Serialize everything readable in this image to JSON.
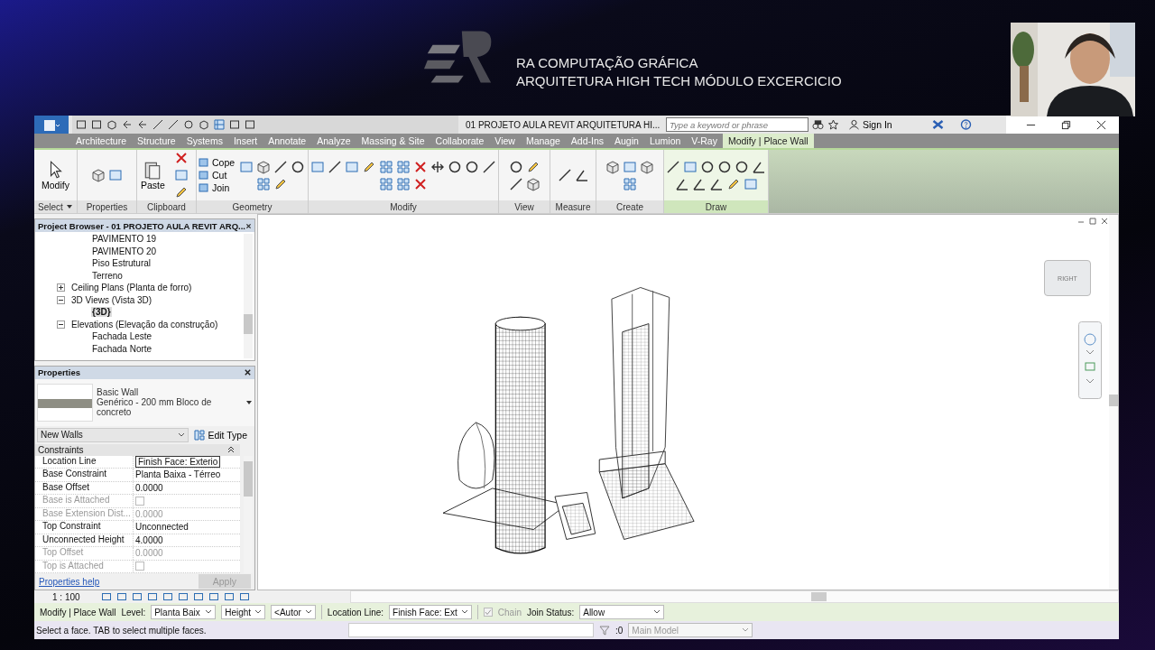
{
  "header": {
    "line1": "RA COMPUTAÇÃO GRÁFICA",
    "line2": "ARQUITETURA HIGH TECH MÓDULO EXCERCICIO"
  },
  "titlebar": {
    "title": "01 PROJETO AULA REVIT ARQUITETURA HI...",
    "search_placeholder": "Type a keyword or phrase",
    "sign_in": "Sign In"
  },
  "tabs": [
    {
      "label": "Architecture",
      "selected": false
    },
    {
      "label": "Structure",
      "selected": false
    },
    {
      "label": "Systems",
      "selected": false
    },
    {
      "label": "Insert",
      "selected": false
    },
    {
      "label": "Annotate",
      "selected": false
    },
    {
      "label": "Analyze",
      "selected": false
    },
    {
      "label": "Massing & Site",
      "selected": false
    },
    {
      "label": "Collaborate",
      "selected": false
    },
    {
      "label": "View",
      "selected": false
    },
    {
      "label": "Manage",
      "selected": false
    },
    {
      "label": "Add-Ins",
      "selected": false
    },
    {
      "label": "Augin",
      "selected": false
    },
    {
      "label": "Lumion",
      "selected": false
    },
    {
      "label": "V-Ray",
      "selected": false
    },
    {
      "label": "Modify | Place Wall",
      "selected": true
    }
  ],
  "ribbon": [
    {
      "label": "Select",
      "kind": "large",
      "menu": true,
      "buttons": [
        "Modify"
      ]
    },
    {
      "label": "Properties",
      "kind": "icons",
      "menu": false
    },
    {
      "label": "Clipboard",
      "kind": "large",
      "menu": false,
      "buttons": [
        "Paste"
      ]
    },
    {
      "label": "Geometry",
      "kind": "list",
      "menu": false,
      "buttons": [
        "Cope",
        "Cut",
        "Join"
      ]
    },
    {
      "label": "Modify",
      "kind": "icons",
      "menu": false
    },
    {
      "label": "View",
      "kind": "icons",
      "menu": false
    },
    {
      "label": "Measure",
      "kind": "icons",
      "menu": false
    },
    {
      "label": "Create",
      "kind": "icons",
      "menu": false
    },
    {
      "label": "Draw",
      "kind": "icons",
      "menu": false
    }
  ],
  "project_browser": {
    "title": "Project Browser - 01 PROJETO AULA REVIT ARQ...",
    "continued": [
      {
        "label": "PAVIMENTO 19",
        "selected": false
      },
      {
        "label": "PAVIMENTO 20",
        "selected": false
      },
      {
        "label": "Piso Estrutural",
        "selected": false
      },
      {
        "label": "Terreno",
        "selected": false
      }
    ],
    "items": [
      {
        "label": "Ceiling Plans (Planta de forro)",
        "expanded": false
      },
      {
        "label": "3D Views (Vista 3D)",
        "expanded": true,
        "children": [
          {
            "label": "{3D}",
            "selected": true
          }
        ]
      },
      {
        "label": "Elevations (Elevação da construção)",
        "expanded": true,
        "children": [
          {
            "label": "Fachada Leste",
            "selected": false
          },
          {
            "label": "Fachada Norte",
            "selected": false
          }
        ]
      }
    ]
  },
  "properties": {
    "title": "Properties",
    "family": "Basic Wall",
    "type": "Genérico - 200 mm Bloco de concreto",
    "filter": "New Walls",
    "edit_type": "Edit Type",
    "group": "Constraints",
    "rows": [
      {
        "name": "Location Line",
        "kind": "field",
        "value": "Finish Face: Exterio",
        "disabled": false
      },
      {
        "name": "Base Constraint",
        "kind": "text",
        "value": "Planta Baixa - Térreo",
        "disabled": false
      },
      {
        "name": "Base Offset",
        "kind": "text",
        "value": "0.0000",
        "disabled": false
      },
      {
        "name": "Base is Attached",
        "kind": "checkbox",
        "checked": false,
        "disabled": true
      },
      {
        "name": "Base Extension Dist...",
        "kind": "text",
        "value": "0.0000",
        "disabled": true
      },
      {
        "name": "Top Constraint",
        "kind": "text",
        "value": "Unconnected",
        "disabled": false
      },
      {
        "name": "Unconnected Height",
        "kind": "text",
        "value": "4.0000",
        "disabled": false
      },
      {
        "name": "Top Offset",
        "kind": "text",
        "value": "0.0000",
        "disabled": true
      },
      {
        "name": "Top is Attached",
        "kind": "checkbox",
        "checked": false,
        "disabled": true
      }
    ],
    "help": "Properties help",
    "apply": "Apply"
  },
  "view_cube": {
    "label": "RIGHT"
  },
  "view_bar": {
    "scale": "1 : 100"
  },
  "options_bar": {
    "context": "Modify | Place Wall",
    "level_label": "Level:",
    "level": "Planta Baix",
    "height": "Height",
    "top": "<Autor",
    "location_label": "Location Line:",
    "location": "Finish Face: Ext",
    "chain": "Chain",
    "chain_checked": true,
    "join_label": "Join Status:",
    "join": "Allow"
  },
  "status_bar": {
    "message": "Select a face.  TAB to select multiple faces.",
    "count": ":0",
    "model": "Main Model"
  }
}
